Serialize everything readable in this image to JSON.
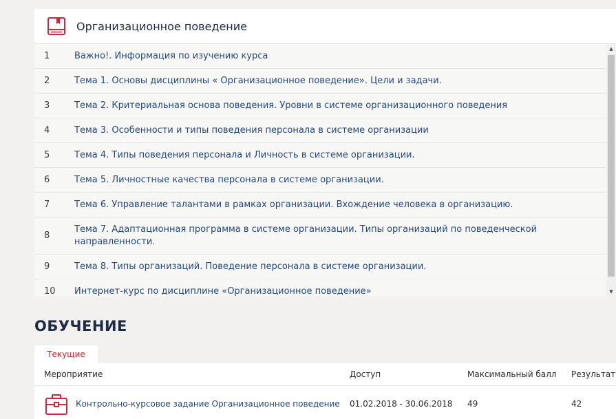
{
  "course": {
    "title": "Организационное поведение",
    "icon": "book-icon",
    "accent_color": "#d6243a",
    "topics": [
      {
        "num": "1",
        "title": "Важно!. Информация по изучению курса"
      },
      {
        "num": "2",
        "title": "Тема 1. Основы дисциплины « Организационное поведение». Цели и задачи."
      },
      {
        "num": "3",
        "title": "Тема 2. Критериальная основа поведения. Уровни в системе организационного поведения"
      },
      {
        "num": "4",
        "title": "Тема 3. Особенности и типы поведения персонала в системе организации"
      },
      {
        "num": "5",
        "title": "Тема 4. Типы поведения персонала и Личность в системе организации."
      },
      {
        "num": "6",
        "title": "Тема 5. Личностные качества персонала в системе организации."
      },
      {
        "num": "7",
        "title": "Тема 6. Управление талантами в рамках организации. Вхождение человека в организацию."
      },
      {
        "num": "8",
        "title": "Тема 7. Адаптационная программа в системе организации. Типы организаций по поведенческой направленности."
      },
      {
        "num": "9",
        "title": "Тема 8. Типы организаций. Поведение персонала в системе организации."
      },
      {
        "num": "10",
        "title": "Интернет-курс по дисциплине «Организационное поведение»"
      }
    ]
  },
  "learning": {
    "heading": "ОБУЧЕНИЕ",
    "tab_current": "Текущие",
    "columns": {
      "event": "Мероприятие",
      "access": "Доступ",
      "max_score": "Максимальный балл",
      "result": "Результат"
    },
    "rows": [
      {
        "icon": "briefcase-icon",
        "event": "Контрольно-курсовое задание Организационное поведение",
        "access": "01.02.2018 - 30.06.2018",
        "max_score": "49",
        "result": "42"
      }
    ]
  }
}
